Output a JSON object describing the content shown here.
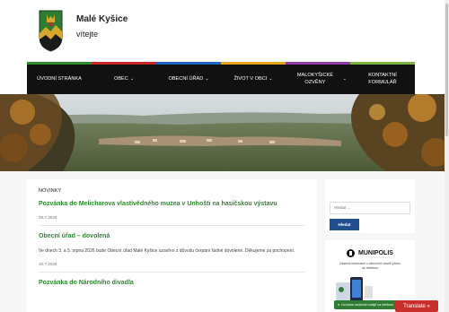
{
  "header": {
    "site_name": "Malé Kyšice",
    "tagline": "vítejte"
  },
  "nav": {
    "accent_colors": [
      "#2e8b2e",
      "#c62828",
      "#1e66c8",
      "#e8a21b",
      "#8e3aa8",
      "#7cb342"
    ],
    "items": [
      {
        "label": "ÚVODNÍ STRÁNKA",
        "dropdown": false
      },
      {
        "label": "OBEC",
        "dropdown": true
      },
      {
        "label": "OBECNÍ ÚŘAD",
        "dropdown": true
      },
      {
        "label": "ŽIVOT V OBCI",
        "dropdown": true
      },
      {
        "label": "MALOKYŠICKÉ OZVĚNY",
        "dropdown": true
      },
      {
        "label": "KONTAKTNÍ FORMULÁŘ",
        "dropdown": false
      }
    ]
  },
  "news": {
    "section_title": "NOVINKY",
    "posts": [
      {
        "title": "Pozvánka do Melicharova vlastivědného muzea v Unhošti na hasičskou výstavu",
        "text": "",
        "date": "29.7.2026"
      },
      {
        "title": "Obecní úřad – dovolená",
        "text": "Ve dnech 3. a 5. srpna 2026 bude Obecní úřad Malé Kyšice uzavřen z důvodu čerpání řádné dovolené. Děkujeme za pochopení.",
        "date": "10.7.2026"
      },
      {
        "title": "Pozvánka do Národního divadla",
        "text": "",
        "date": ""
      }
    ]
  },
  "sidebar": {
    "search_placeholder": "Hledat …",
    "search_button": "Hledat",
    "munipolis_name": "MUNIPOLIS",
    "munipolis_desc": "Zdarma informace z obecních úřadů přímo do telefonu"
  },
  "widgets": {
    "gdpr_label": "Ochrana osobních údajů na telefonu",
    "translate_label": "Translate »"
  }
}
